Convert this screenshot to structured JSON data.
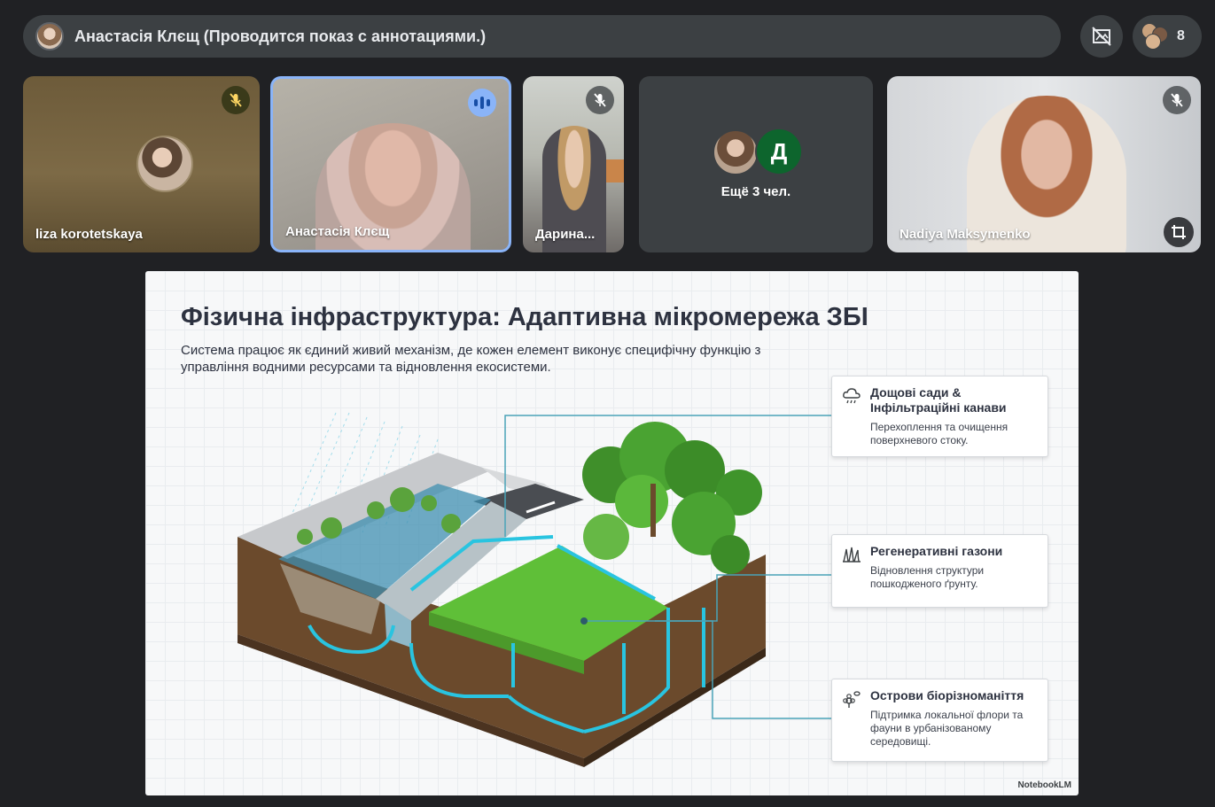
{
  "presenter": {
    "banner": "Анастасія Клєщ (Проводится показ с аннотациями.)"
  },
  "people": {
    "count": "8"
  },
  "tiles": [
    {
      "name": "liza korotetskaya"
    },
    {
      "name": "Анастасія Клєщ"
    },
    {
      "name": "Дарина..."
    },
    {
      "more_label": "Ещё 3 чел.",
      "avatar_letter": "Д"
    },
    {
      "name": "Nadiya Maksymenko"
    }
  ],
  "slide": {
    "title": "Фізична інфраструктура: Адаптивна мікромережа ЗБІ",
    "subtitle": "Система працює як єдиний живий механізм, де кожен елемент виконує специфічну функцію з управління водними ресурсами та відновлення екосистеми.",
    "callouts": [
      {
        "icon": "rain-cloud-icon",
        "heading": "Дощові сади & Інфільтраційні канави",
        "body": "Перехоплення та очищення поверхневого стоку."
      },
      {
        "icon": "grass-icon",
        "heading": "Регенеративні газони",
        "body": "Відновлення структури пошкодженого ґрунту."
      },
      {
        "icon": "bee-flower-icon",
        "heading": "Острови біорізноманіття",
        "body": "Підтримка локальної флори та фауни в урбанізованому середовищі."
      }
    ],
    "brand": "NotebookLM"
  },
  "colors": {
    "background": "#202124",
    "surface": "#3c4043",
    "speaking_accent": "#8ab4f8",
    "water_flow": "#29c4e0"
  }
}
